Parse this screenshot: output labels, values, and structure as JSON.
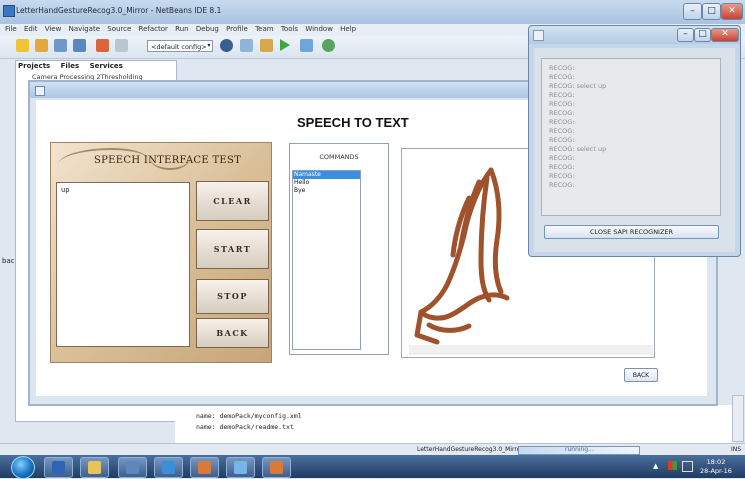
{
  "netbeans": {
    "title": "LetterHandGestureRecog3.0_Mirror - NetBeans IDE 8.1",
    "menus": [
      "File",
      "Edit",
      "View",
      "Navigate",
      "Source",
      "Refactor",
      "Run",
      "Debug",
      "Profile",
      "Team",
      "Tools",
      "Window",
      "Help"
    ],
    "config": "<default config>",
    "projects_tabs": [
      "Projects",
      "Files",
      "Services"
    ],
    "project_item": "Camera Processing 2Thresholding",
    "side_label": "bac",
    "output_lines": [
      "name: demoPack/myconfig.xml",
      "name: demoPack/readme.txt"
    ],
    "status_project": "LetterHandGestureRecog3.0_Mirror (run)",
    "status_running": "running...",
    "status_mode": "INS",
    "window_buttons": [
      "–",
      "□",
      "✕"
    ]
  },
  "app": {
    "title": "SPEECH TO TEXT",
    "panel_title": "SPEECH INTERFACE TEST",
    "transcript": "up",
    "buttons": {
      "clear": "CLEAR",
      "start": "START",
      "stop": "STOP",
      "back": "BACK"
    },
    "commands": {
      "header": "COMMANDS",
      "items": [
        "Namaste",
        "Hello",
        "Bye"
      ],
      "selected": "Namaste"
    },
    "back_button": "BACK",
    "image_description_icon": "praying-hands-icon"
  },
  "sapi": {
    "log": [
      "RECOG:",
      "RECOG:",
      "RECOG: select up",
      "RECOG:",
      "RECOG:",
      "RECOG:",
      "RECOG:",
      "RECOG:",
      "RECOG:",
      "RECOG: select up",
      "RECOG:",
      "RECOG:",
      "RECOG:",
      "RECOG:"
    ],
    "close_button": "CLOSE SAPI RECOGNIZER"
  },
  "taskbar": {
    "time": "18:02",
    "date": "28-Apr-16"
  },
  "colors": {
    "accent": "#3b8fe1",
    "hands": "#a0522d"
  }
}
